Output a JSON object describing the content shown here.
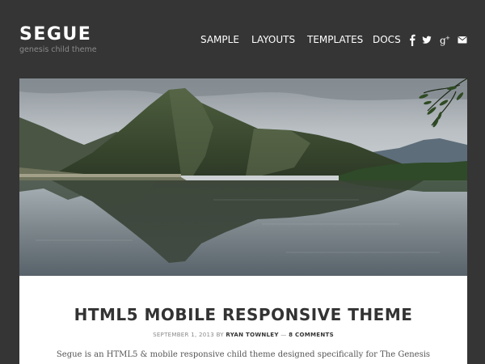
{
  "site": {
    "title": "SEGUE",
    "description": "genesis child theme"
  },
  "nav": {
    "items": [
      {
        "label": "SAMPLE"
      },
      {
        "label": "LAYOUTS"
      },
      {
        "label": "TEMPLATES"
      },
      {
        "label": "DOCS"
      }
    ],
    "social_icons": [
      "facebook-icon",
      "twitter-icon",
      "google-plus-icon",
      "email-icon"
    ]
  },
  "post": {
    "title": "HTML5 MOBILE RESPONSIVE THEME",
    "date": "SEPTEMBER 1, 2013",
    "by": "BY",
    "author": "RYAN TOWNLEY",
    "separator": "—",
    "comments": "8 COMMENTS",
    "excerpt": "Segue is an HTML5 & mobile responsive child theme designed specifically for The Genesis"
  },
  "colors": {
    "background": "#353535",
    "card": "#ffffff",
    "title_text": "#333333",
    "meta_text": "#8a8a8a"
  }
}
